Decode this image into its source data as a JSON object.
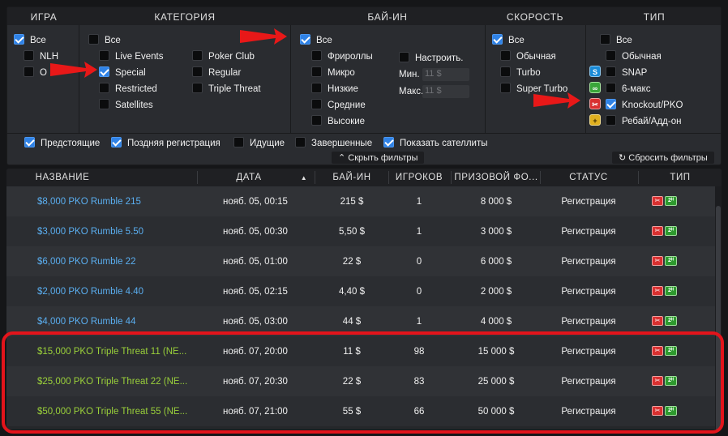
{
  "filters": {
    "headers": {
      "game": "ИГРА",
      "category": "КАТЕГОРИЯ",
      "buyin": "БАЙ-ИН",
      "speed": "СКОРОСТЬ",
      "type": "ТИП"
    },
    "game": [
      {
        "label": "Все",
        "checked": true
      },
      {
        "label": "NLH",
        "checked": false
      },
      {
        "label": "O",
        "checked": false
      }
    ],
    "category": [
      {
        "label": "Все",
        "checked": false
      },
      {
        "label": "Live Events",
        "checked": false
      },
      {
        "label": "Special",
        "checked": true
      },
      {
        "label": "Restricted",
        "checked": false
      },
      {
        "label": "Satellites",
        "checked": false
      },
      {
        "label": "Poker Club",
        "checked": false
      },
      {
        "label": "Regular",
        "checked": false
      },
      {
        "label": "Triple Threat",
        "checked": false
      }
    ],
    "buyin": {
      "all": {
        "label": "Все",
        "checked": true
      },
      "items": [
        {
          "label": "Фрироллы",
          "checked": false
        },
        {
          "label": "Микро",
          "checked": false
        },
        {
          "label": "Низкие",
          "checked": false
        },
        {
          "label": "Средние",
          "checked": false
        },
        {
          "label": "Высокие",
          "checked": false
        }
      ],
      "custom": {
        "label": "Настроить.",
        "checked": false
      },
      "min_label": "Мин.",
      "min_value": "11 $",
      "max_label": "Макс.",
      "max_value": "11 $"
    },
    "speed": [
      {
        "label": "Все",
        "checked": true
      },
      {
        "label": "Обычная",
        "checked": false
      },
      {
        "label": "Turbo",
        "checked": false
      },
      {
        "label": "Super Turbo",
        "checked": false
      }
    ],
    "type": [
      {
        "label": "Все",
        "checked": false,
        "icon": ""
      },
      {
        "label": "Обычная",
        "checked": false,
        "icon": ""
      },
      {
        "label": "SNAP",
        "checked": false,
        "icon": "snap-icon"
      },
      {
        "label": "6-макс",
        "checked": false,
        "icon": "six-max-icon"
      },
      {
        "label": "Knockout/PKO",
        "checked": true,
        "icon": "knockout-icon"
      },
      {
        "label": "Ребай/Адд-он",
        "checked": false,
        "icon": "rebuy-icon"
      }
    ],
    "status": [
      {
        "label": "Предстоящие",
        "checked": true
      },
      {
        "label": "Поздняя регистрация",
        "checked": true
      },
      {
        "label": "Идущие",
        "checked": false
      },
      {
        "label": "Завершенные",
        "checked": false
      },
      {
        "label": "Показать сателлиты",
        "checked": true
      }
    ],
    "hide_button": "Скрыть фильтры",
    "reset_button": "Сбросить фильтры"
  },
  "table": {
    "columns": [
      "НАЗВАНИЕ",
      "ДАТА",
      "БАЙ-ИН",
      "ИГРОКОВ",
      "ПРИЗОВОЙ ФО...",
      "СТАТУС",
      "ТИП"
    ],
    "sorted_column": "ДАТА",
    "rows": [
      {
        "name": "$8,000 PKO Rumble 215",
        "date": "нояб. 05, 00:15",
        "buyin": "215 $",
        "players": "1",
        "prize": "8 000 $",
        "status": "Регистрация",
        "color": "#5aaef0"
      },
      {
        "name": "$3,000 PKO Rumble 5.50",
        "date": "нояб. 05, 00:30",
        "buyin": "5,50 $",
        "players": "1",
        "prize": "3 000 $",
        "status": "Регистрация",
        "color": "#5aaef0"
      },
      {
        "name": "$6,000 PKO Rumble 22",
        "date": "нояб. 05, 01:00",
        "buyin": "22 $",
        "players": "0",
        "prize": "6 000 $",
        "status": "Регистрация",
        "color": "#5aaef0"
      },
      {
        "name": "$2,000 PKO Rumble 4.40",
        "date": "нояб. 05, 02:15",
        "buyin": "4,40 $",
        "players": "0",
        "prize": "2 000 $",
        "status": "Регистрация",
        "color": "#5aaef0"
      },
      {
        "name": "$4,000 PKO Rumble 44",
        "date": "нояб. 05, 03:00",
        "buyin": "44 $",
        "players": "1",
        "prize": "4 000 $",
        "status": "Регистрация",
        "color": "#5aaef0"
      },
      {
        "name": "$15,000 PKO Triple Threat 11 (NE...",
        "date": "нояб. 07, 20:00",
        "buyin": "11 $",
        "players": "98",
        "prize": "15 000 $",
        "status": "Регистрация",
        "color": "#9ad03a"
      },
      {
        "name": "$25,000 PKO Triple Threat 22 (NE...",
        "date": "нояб. 07, 20:30",
        "buyin": "22 $",
        "players": "83",
        "prize": "25 000 $",
        "status": "Регистрация",
        "color": "#9ad03a"
      },
      {
        "name": "$50,000 PKO Triple Threat 55 (NE...",
        "date": "нояб. 07, 21:00",
        "buyin": "55 $",
        "players": "66",
        "prize": "50 000 $",
        "status": "Регистрация",
        "color": "#9ad03a"
      }
    ]
  },
  "type_badge": {
    "ko": "✂",
    "players": "2ᴴ"
  },
  "colors": {
    "accent_blue": "#2f82e6",
    "name_blue": "#5aaef0",
    "name_green": "#9ad03a",
    "highlight_red": "#e3141b"
  }
}
